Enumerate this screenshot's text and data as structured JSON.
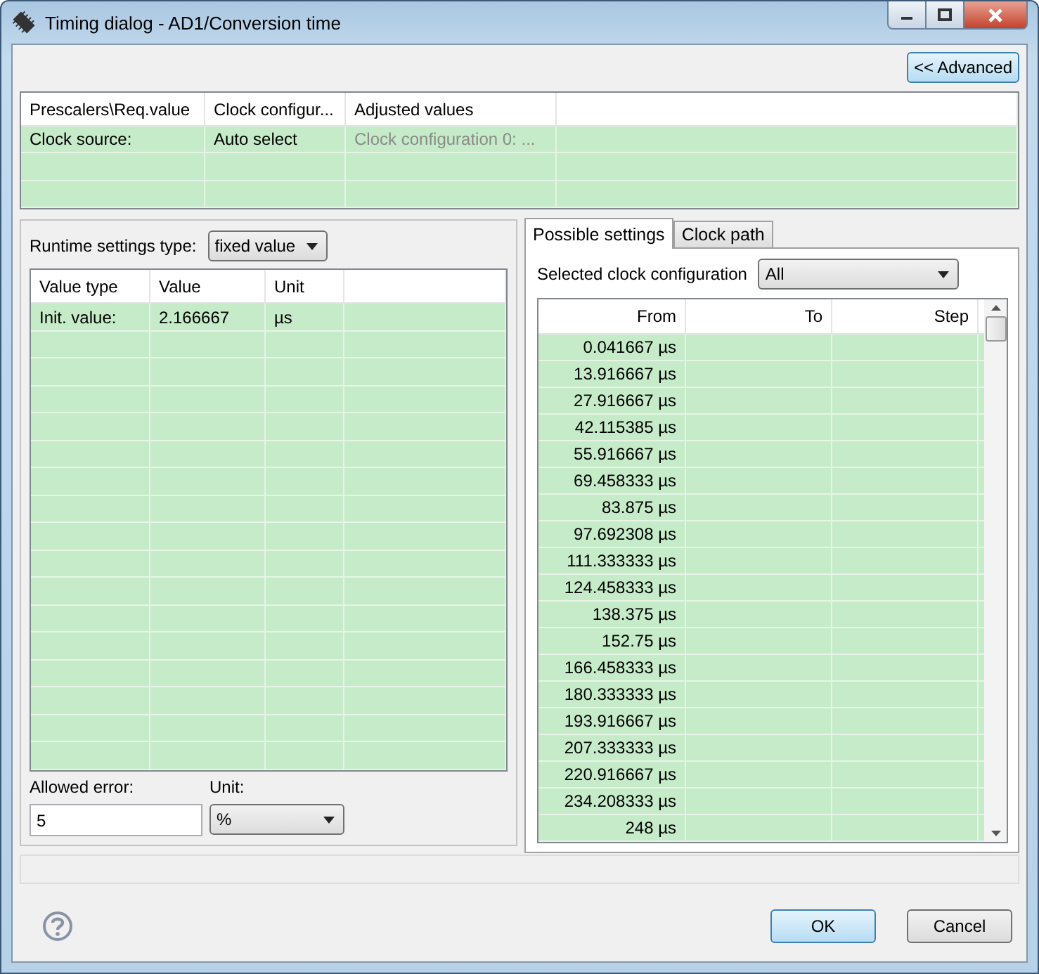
{
  "window": {
    "title": "Timing dialog - AD1/Conversion time"
  },
  "advanced_button": "<< Advanced",
  "prescaler_table": {
    "columns": [
      "Prescalers\\Req.value",
      "Clock configur...",
      "Adjusted values"
    ],
    "rows": [
      {
        "cells": [
          {
            "text": "Clock source:",
            "greyed": false
          },
          {
            "text": "Auto select",
            "greyed": false
          },
          {
            "text": "Clock configuration 0: ...",
            "greyed": true
          }
        ]
      }
    ]
  },
  "runtime_settings": {
    "label": "Runtime settings type:",
    "value": "fixed value"
  },
  "value_table": {
    "columns": [
      "Value type",
      "Value",
      "Unit"
    ],
    "rows": [
      [
        "Init. value:",
        "2.166667",
        "µs"
      ]
    ]
  },
  "allowed_error": {
    "label": "Allowed error:",
    "value": "5"
  },
  "unit": {
    "label": "Unit:",
    "value": "%"
  },
  "tabs": [
    {
      "label": "Possible settings",
      "selected": true
    },
    {
      "label": "Clock path",
      "selected": false
    }
  ],
  "clock_configuration": {
    "label": "Selected clock configuration",
    "value": "All"
  },
  "settings_table": {
    "columns": [
      "From",
      "To",
      "Step"
    ],
    "rows": [
      "0.041667 µs",
      "13.916667 µs",
      "27.916667 µs",
      "42.115385 µs",
      "55.916667 µs",
      "69.458333 µs",
      "83.875 µs",
      "97.692308 µs",
      "111.333333 µs",
      "124.458333 µs",
      "138.375 µs",
      "152.75 µs",
      "166.458333 µs",
      "180.333333 µs",
      "193.916667 µs",
      "207.333333 µs",
      "220.916667 µs",
      "234.208333 µs",
      "248 µs"
    ]
  },
  "buttons": [
    {
      "label": "OK",
      "default": true
    },
    {
      "label": "Cancel",
      "default": false
    }
  ]
}
